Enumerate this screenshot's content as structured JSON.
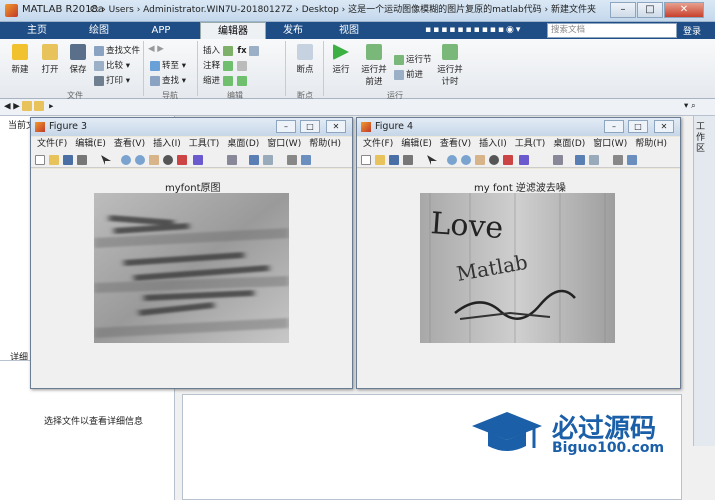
{
  "app": {
    "title": "MATLAB R2018a"
  },
  "tabs": [
    "主页",
    "绘图",
    "APP",
    "编辑器",
    "发布",
    "视图"
  ],
  "search_placeholder": "搜索文档",
  "login": "登录",
  "ribbon": {
    "new": "新建",
    "open": "打开",
    "save": "保存",
    "find_files": "查找文件",
    "compare": "比较",
    "print": "打印",
    "go_to": "转至",
    "find": "查找",
    "insert": "插入",
    "comment": "注释",
    "indent": "缩进",
    "breakpoints": "断点",
    "run": "运行",
    "run_advance": "运行并\n前进",
    "run_section": "运行节",
    "advance": "前进",
    "run_time": "运行并\n计时",
    "groups": [
      "文件",
      "导航",
      "编辑",
      "断点",
      "运行"
    ]
  },
  "address": {
    "path": "C: › Users › Administrator.WIN7U-20180127Z › Desktop › 这是一个运动图像模糊的图片复原的matlab代码 › 新建文件夹"
  },
  "left": {
    "current_folder": "当前文",
    "details": "详细",
    "details_hint": "选择文件以查看详细信息"
  },
  "right_strip": "工作区",
  "figure3": {
    "title": "Figure 3",
    "menu": [
      "文件(F)",
      "编辑(E)",
      "查看(V)",
      "插入(I)",
      "工具(T)",
      "桌面(D)",
      "窗口(W)",
      "帮助(H)"
    ],
    "plot_title": "myfont原图"
  },
  "figure4": {
    "title": "Figure 4",
    "menu": [
      "文件(F)",
      "编辑(E)",
      "查看(V)",
      "插入(I)",
      "工具(T)",
      "桌面(D)",
      "窗口(W)",
      "帮助(H)"
    ],
    "plot_title": "my font 逆滤波去噪",
    "restored_text": [
      "Love",
      "Matlab"
    ]
  },
  "watermark": {
    "line1": "必过源码",
    "line2": "Biguo100.com"
  },
  "colors": {
    "tab_bar": "#1f4e86",
    "brand": "#1a5fa8"
  }
}
